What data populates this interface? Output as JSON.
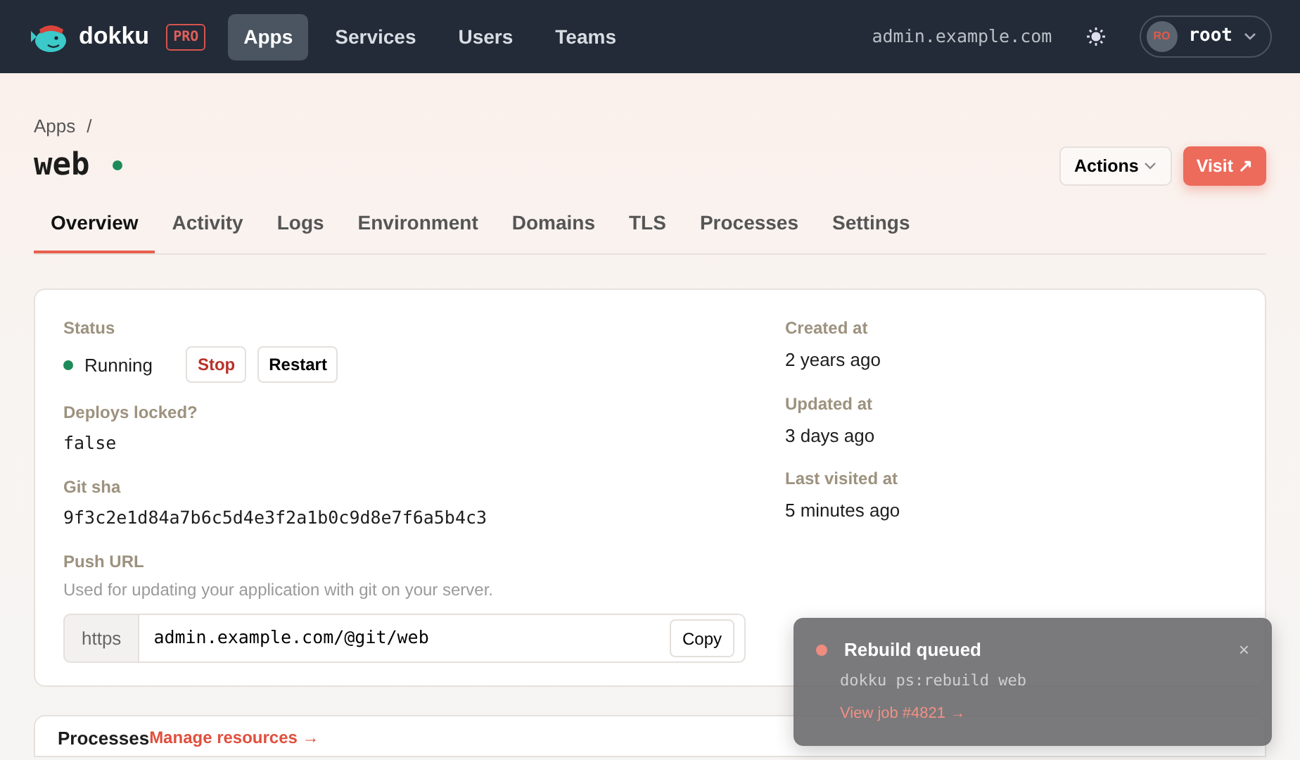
{
  "navbar": {
    "brand": "dokku",
    "badge": "PRO",
    "items": [
      {
        "label": "Apps",
        "selected": true
      },
      {
        "label": "Services",
        "selected": false
      },
      {
        "label": "Users",
        "selected": false
      },
      {
        "label": "Teams",
        "selected": false
      }
    ],
    "host": "admin.example.com",
    "user": {
      "initials": "RO",
      "name": "root"
    }
  },
  "breadcrumb": [
    {
      "label": "Apps",
      "separator": "/"
    }
  ],
  "app": {
    "title": "web",
    "actions": "Actions",
    "visit": "Visit ↗"
  },
  "tabs": [
    {
      "label": "Overview",
      "selected": true
    },
    {
      "label": "Activity",
      "selected": false
    },
    {
      "label": "Logs",
      "selected": false
    },
    {
      "label": "Environment",
      "selected": false
    },
    {
      "label": "Domains",
      "selected": false
    },
    {
      "label": "TLS",
      "selected": false
    },
    {
      "label": "Processes",
      "selected": false
    },
    {
      "label": "Settings",
      "selected": false
    }
  ],
  "overview": {
    "fields": [
      {
        "kind": "status",
        "label": "Status",
        "value": "Running",
        "buttons": [
          {
            "label": "Stop",
            "kind": "danger"
          },
          {
            "label": "Restart",
            "kind": "plain"
          }
        ]
      },
      {
        "kind": "code",
        "label": "Deploys locked?",
        "value": "false"
      },
      {
        "kind": "code",
        "label": "Git sha",
        "value": "9f3c2e1d84a7b6c5d4e3f2a1b0c9d8e7f6a5b4c3"
      },
      {
        "kind": "url",
        "label": "Push URL",
        "help": "Used for updating your application with git on your server.",
        "prefix": "https",
        "value": "admin.example.com/@git/web",
        "button": "Copy"
      }
    ],
    "meta": [
      {
        "label": "Created at",
        "value": "2 years ago"
      },
      {
        "label": "Updated at",
        "value": "3 days ago"
      },
      {
        "label": "Last visited at",
        "value": "5 minutes ago"
      }
    ]
  },
  "processes": {
    "title": "Processes",
    "link": "Manage resources →"
  },
  "toast": {
    "title": "Rebuild queued",
    "command": "dokku ps:rebuild web",
    "link": "View job #4821 →",
    "close": "×"
  }
}
